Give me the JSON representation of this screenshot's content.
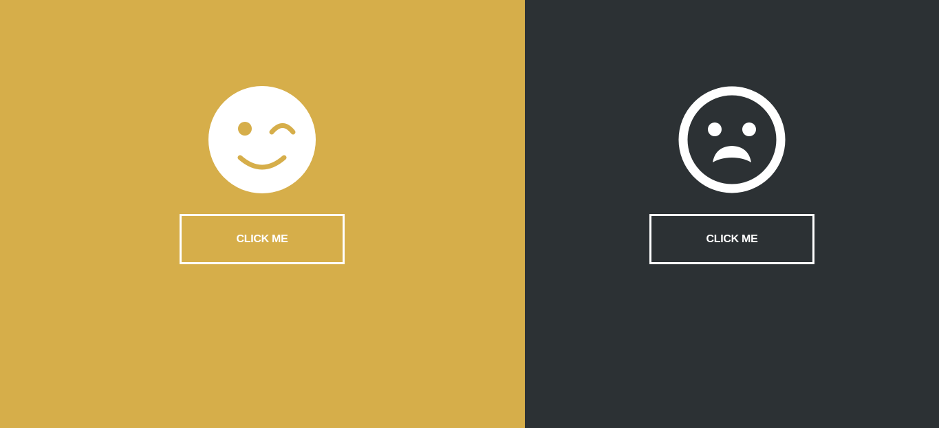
{
  "panels": [
    {
      "id": "happy",
      "background": "#d6ae4a",
      "icon": "winking-smiley-icon",
      "button_label": "CLICK ME"
    },
    {
      "id": "sad",
      "background": "#2c3134",
      "icon": "sad-face-icon",
      "button_label": "CLICK ME"
    }
  ],
  "colors": {
    "foreground": "#ffffff"
  }
}
